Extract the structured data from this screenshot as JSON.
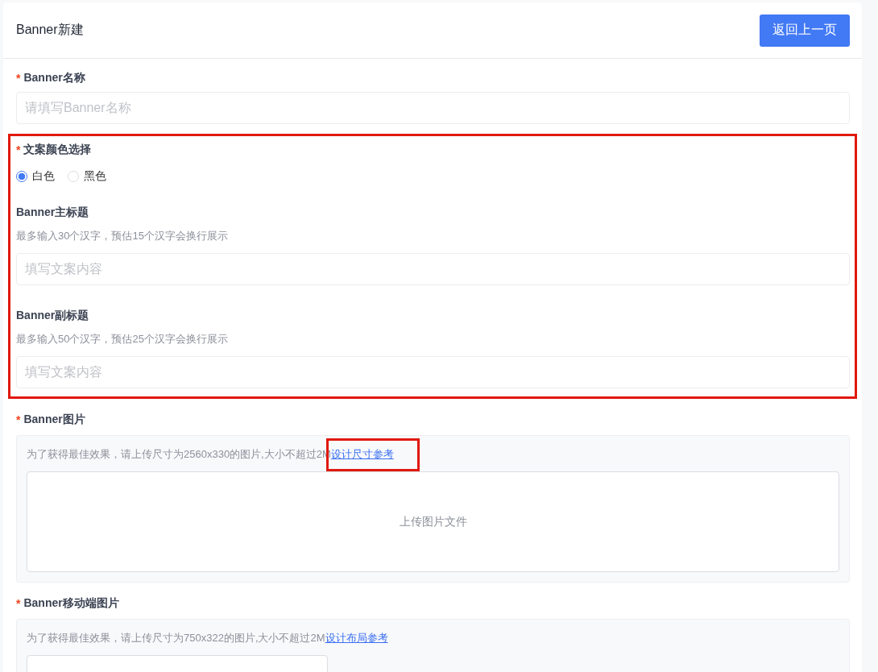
{
  "header": {
    "title": "Banner新建",
    "back_button": "返回上一页"
  },
  "name_field": {
    "required_mark": "*",
    "label": "Banner名称",
    "placeholder": "请填写Banner名称"
  },
  "copy_section": {
    "annotated": true,
    "required_mark": "*",
    "label": "文案颜色选择",
    "color_options": [
      {
        "label": "白色",
        "selected": true
      },
      {
        "label": "黑色",
        "selected": false
      }
    ],
    "subfields": [
      {
        "label": "Banner主标题",
        "hint": "最多输入30个汉字，预估15个汉字会换行展示",
        "placeholder": "填写文案内容"
      },
      {
        "label": "Banner副标题",
        "hint": "最多输入50个汉字，预估25个汉字会换行展示",
        "placeholder": "填写文案内容"
      }
    ]
  },
  "uploads": [
    {
      "required_mark": "*",
      "label": "Banner图片",
      "hint": "为了获得最佳效果，请上传尺寸为2560x330的图片,大小不超过2M",
      "link": "设计尺寸参考",
      "link_annotated": true,
      "upload_text": "上传图片文件",
      "kind": "wide"
    },
    {
      "required_mark": "*",
      "label": "Banner移动端图片",
      "hint": "为了获得最佳效果，请上传尺寸为750x322的图片,大小不超过2M",
      "link": "设计布局参考",
      "link_annotated": false,
      "kind": "narrow"
    }
  ]
}
